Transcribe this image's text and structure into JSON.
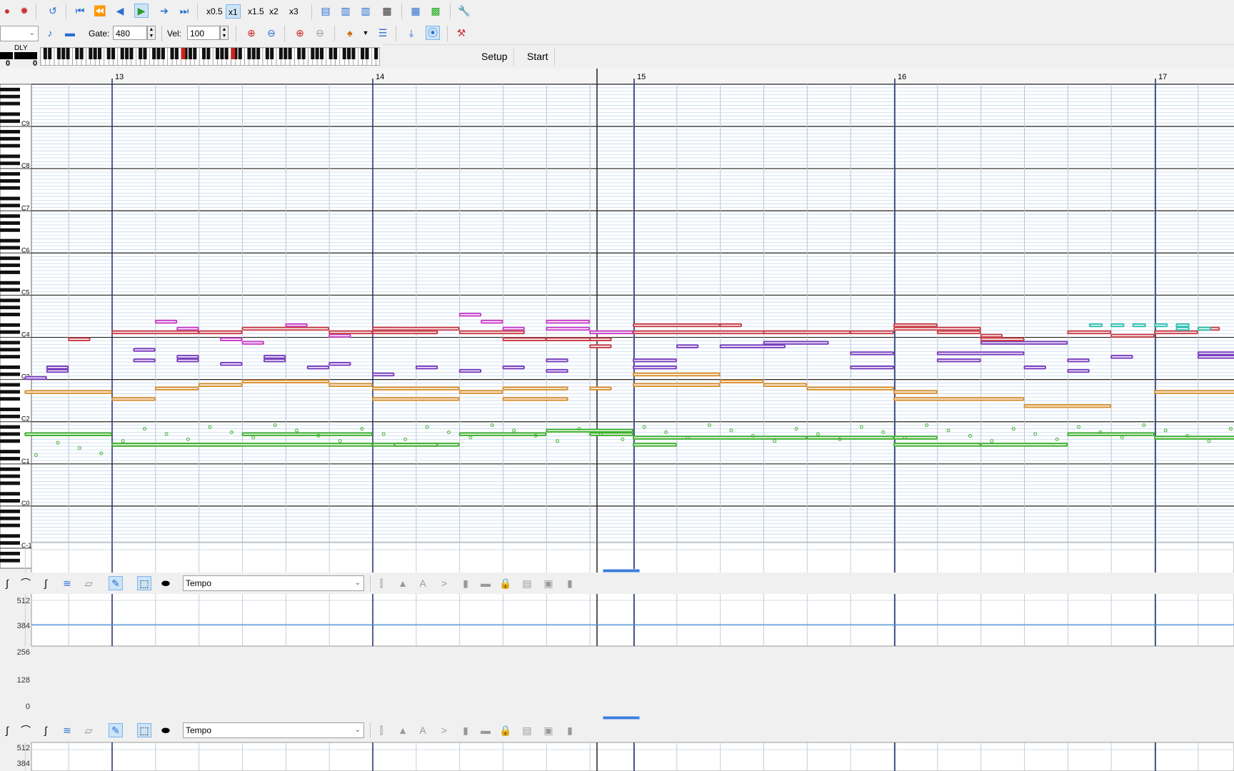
{
  "toolbar_top": {
    "speeds": [
      "x0.5",
      "x1",
      "x1.5",
      "x2",
      "x3"
    ],
    "selected_speed": "x1"
  },
  "toolbar_second": {
    "gate_label": "Gate:",
    "gate_value": "480",
    "vel_label": "Vel:",
    "vel_value": "100",
    "setup_label": "Setup",
    "start_label": "Start"
  },
  "meters": {
    "dly_label": "DLY",
    "left_value": "0",
    "dly_value": "0"
  },
  "piano_roll": {
    "measures": [
      "13",
      "14",
      "15",
      "16",
      "17"
    ],
    "octave_labels": [
      "C9",
      "C8",
      "C7",
      "C6",
      "C5",
      "C4",
      "C3",
      "C2",
      "C1",
      "C0",
      "C-1"
    ]
  },
  "controller_panes": [
    {
      "parameter": "Tempo",
      "ticks": [
        "512",
        "384",
        "256",
        "128",
        "0"
      ]
    },
    {
      "parameter": "Tempo",
      "ticks": [
        "512",
        "384"
      ]
    }
  ],
  "colors": {
    "red": "#c8404a",
    "magenta": "#c840c8",
    "purple": "#7a40c0",
    "orange": "#d89030",
    "green": "#40b030",
    "cyan": "#30c0b0"
  }
}
